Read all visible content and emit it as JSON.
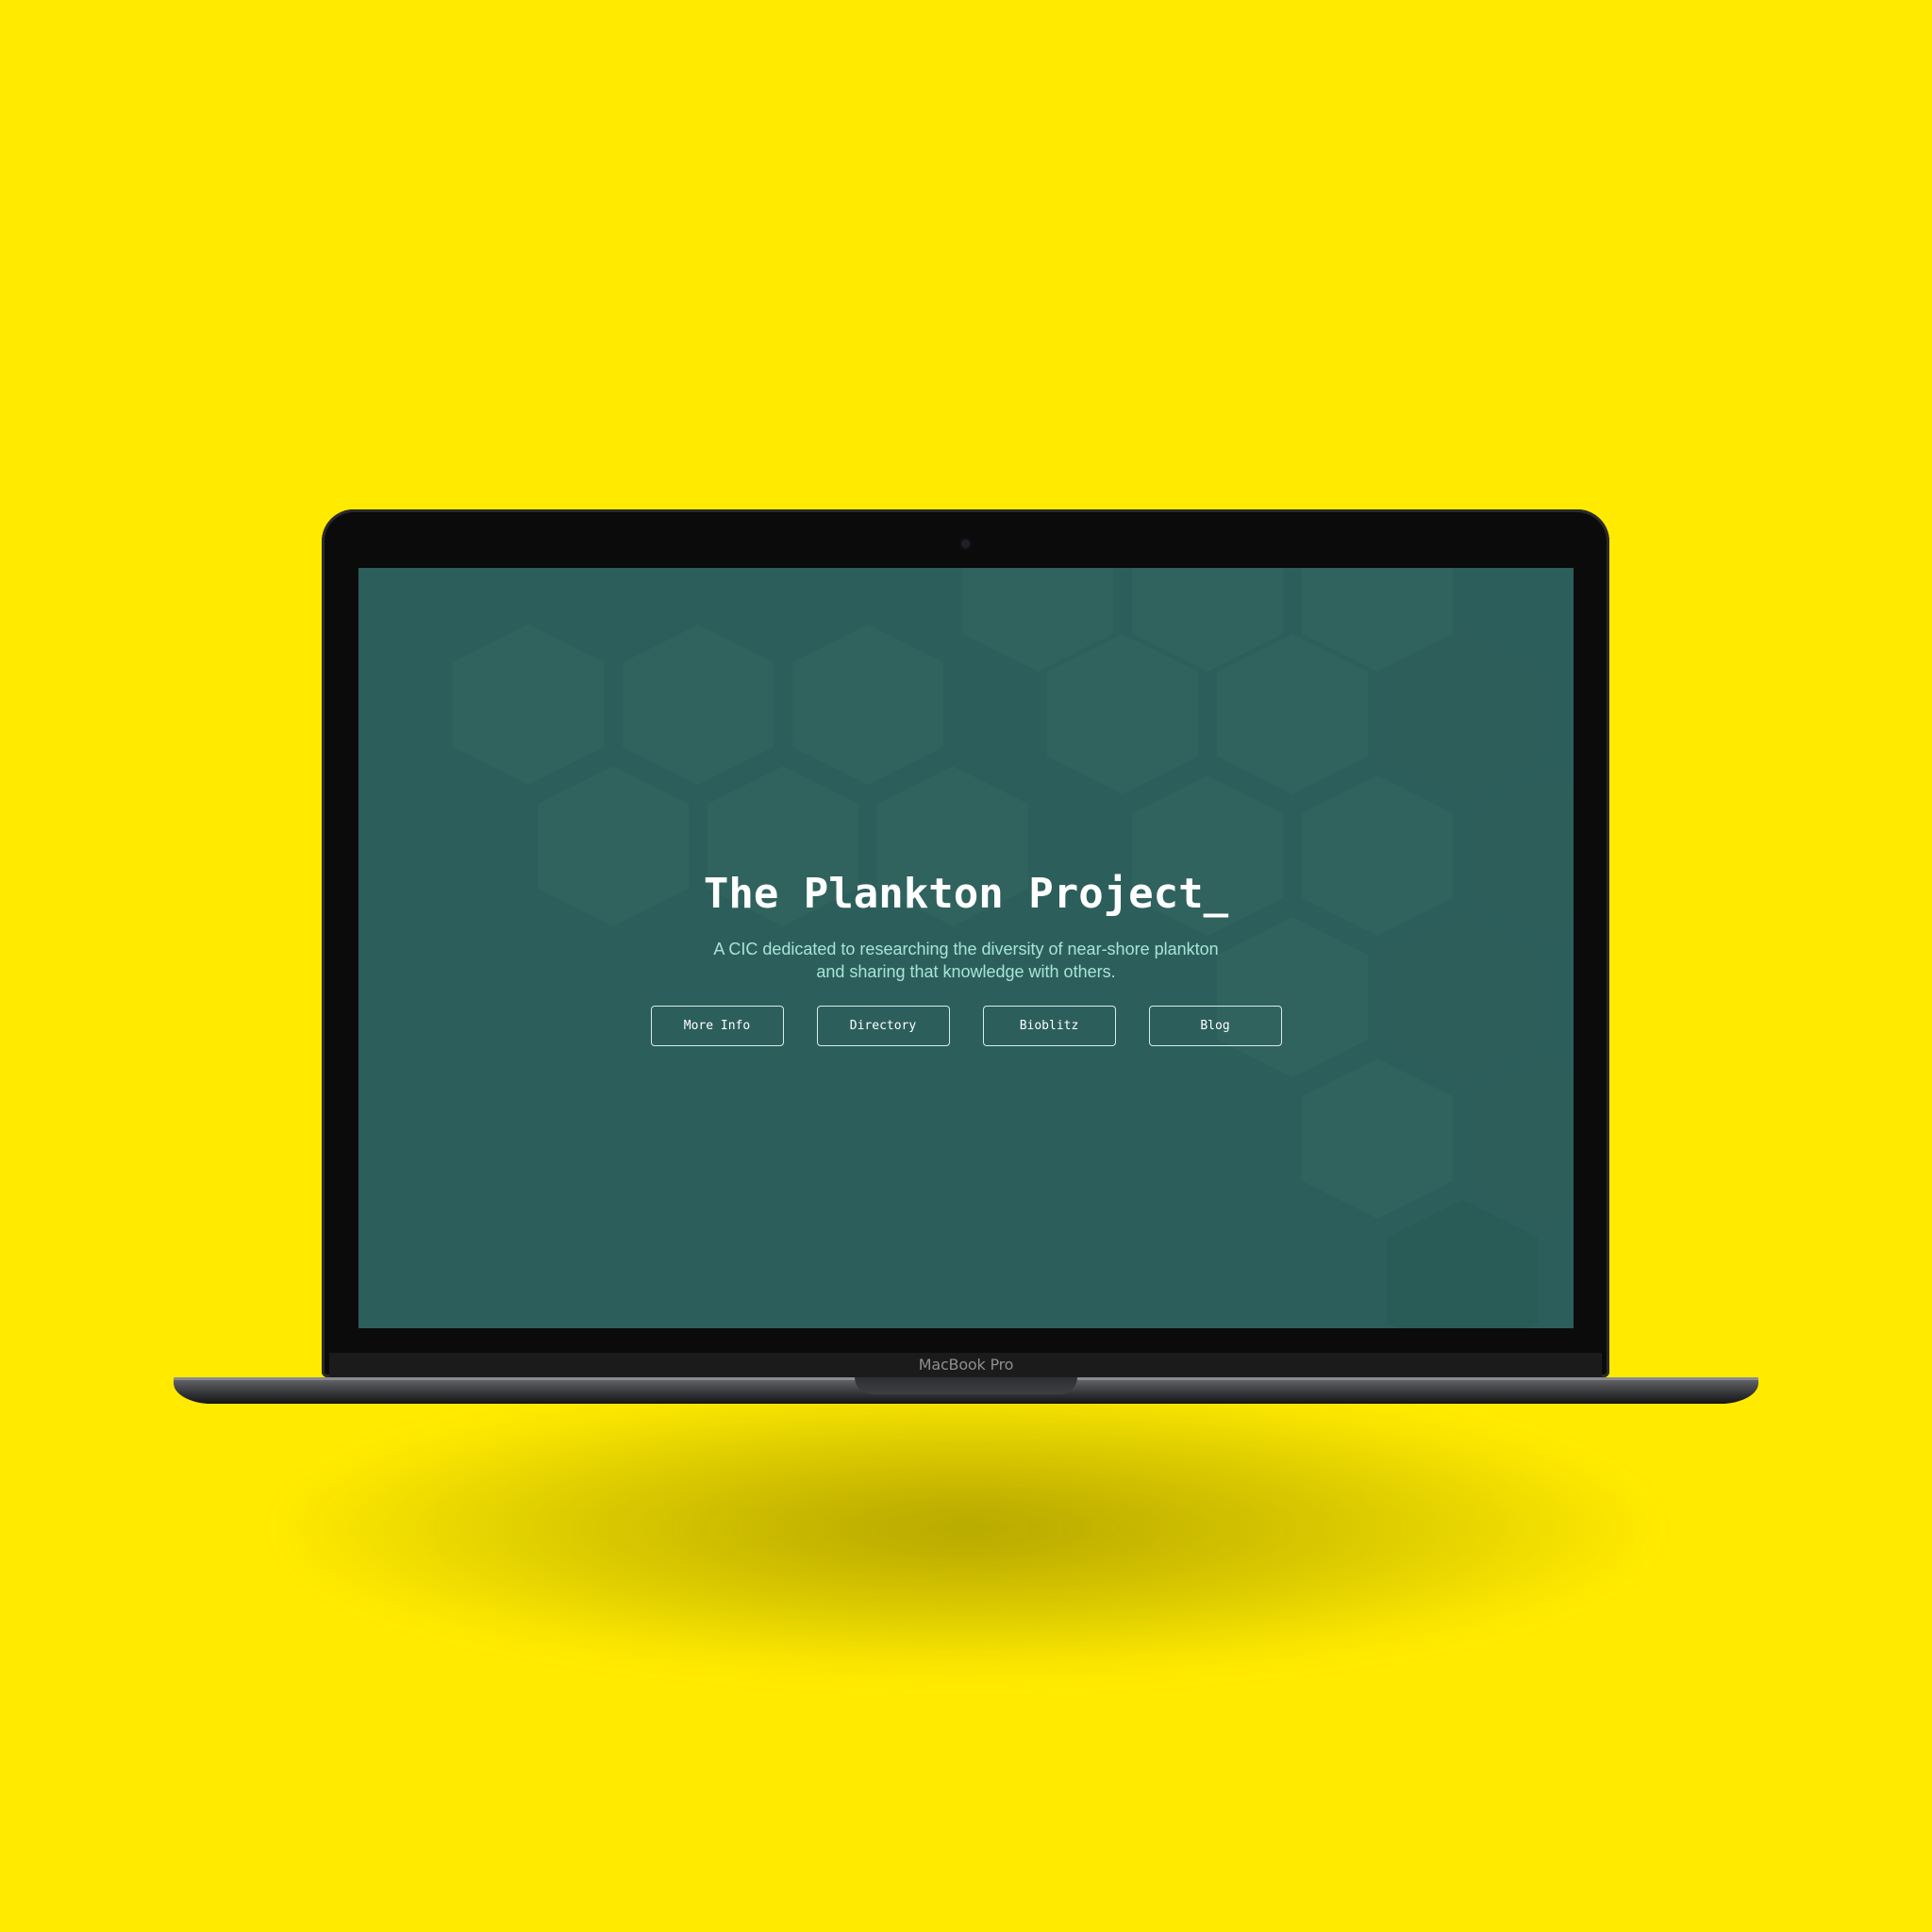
{
  "background_color": "#ffea00",
  "device": {
    "brand_label": "MacBook Pro"
  },
  "site": {
    "title": "The Plankton Project_",
    "subtitle_line1": "A CIC dedicated to researching the diversity of near-shore plankton",
    "subtitle_line2": "and sharing that knowledge with others.",
    "background_color": "#2c5f5b",
    "subtitle_color": "#a7e4d6",
    "nav": [
      {
        "label": "More Info"
      },
      {
        "label": "Directory"
      },
      {
        "label": "Bioblitz"
      },
      {
        "label": "Blog"
      }
    ]
  }
}
